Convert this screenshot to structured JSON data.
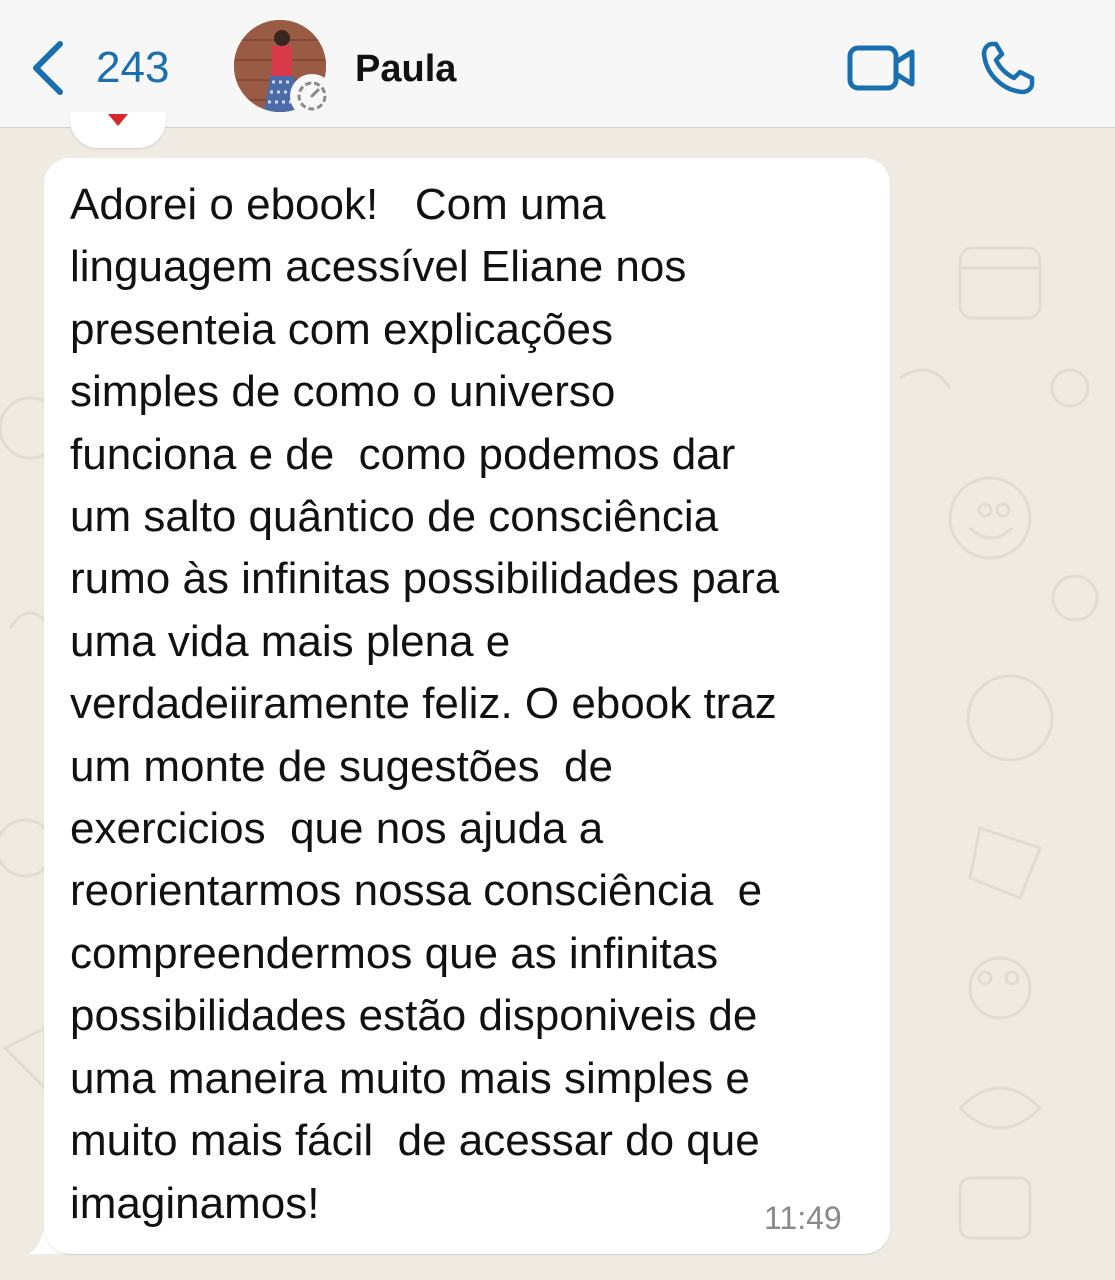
{
  "header": {
    "back_count": "243",
    "contact_name": "Paula",
    "icons": {
      "back": "chevron-left-icon",
      "status": "status-timer-icon",
      "video": "video-camera-icon",
      "call": "phone-icon"
    }
  },
  "message": {
    "lines": [
      "Adorei o ebook!   Com uma",
      "linguagem acessível Eliane nos",
      "presenteia com explicações",
      "simples de como o universo",
      "funciona e de  como podemos dar",
      "um salto quântico de consciência",
      "rumo às infinitas possibilidades para",
      "uma vida mais plena e",
      "verdadeiiramente feliz. O ebook traz",
      "um monte de sugestões  de",
      "exercicios  que nos ajuda a",
      "reorientarmos nossa consciência  e",
      "compreendermos que as infinitas",
      "possibilidades estão disponiveis de",
      "uma maneira muito mais simples e",
      "muito mais fácil  de acessar do que",
      "imaginamos!"
    ],
    "time": "11:49"
  },
  "colors": {
    "accent": "#1a6fb0",
    "wallpaper": "#efeae2",
    "header_bg": "#f7f7f7",
    "bubble": "#ffffff",
    "text": "#111111",
    "timestamp": "#8a8a8a",
    "reaction_heart": "#d9262c"
  }
}
